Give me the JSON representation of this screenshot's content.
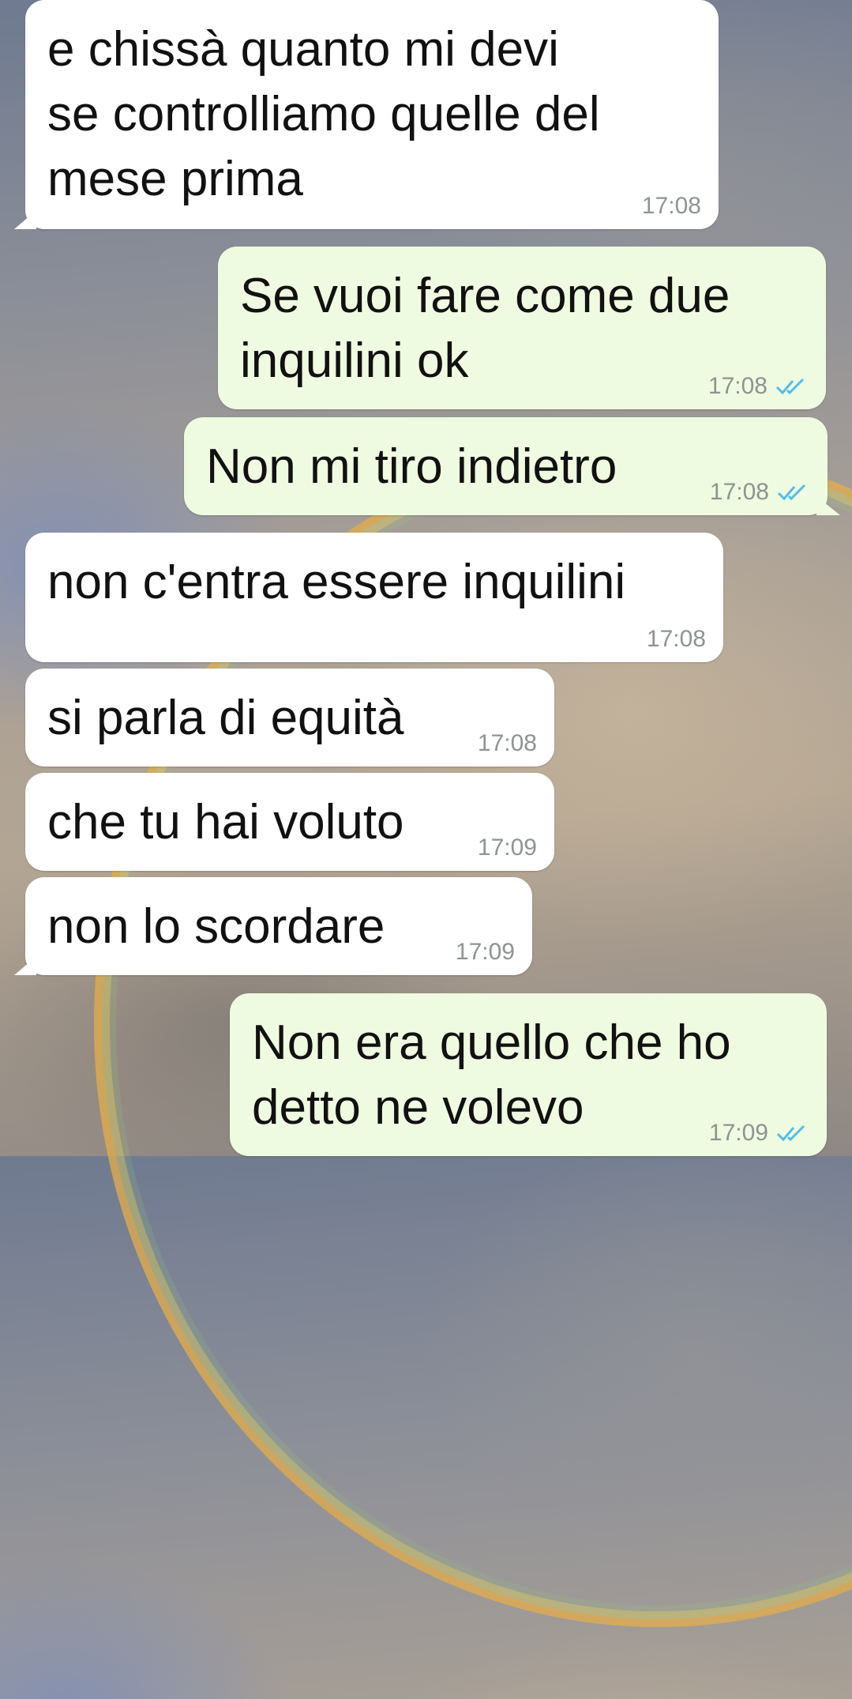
{
  "messages": [
    {
      "text": "e chissà quanto mi devi\nse controlliamo quelle del\nmese prima",
      "time": "17:08"
    },
    {
      "text": "Se vuoi fare come due\ninquilini ok",
      "time": "17:08"
    },
    {
      "text": "Non mi tiro indietro",
      "time": "17:08"
    },
    {
      "text": "non c'entra essere inquilini",
      "time": "17:08"
    },
    {
      "text": "si parla di equità",
      "time": "17:08"
    },
    {
      "text": "che tu hai voluto",
      "time": "17:09"
    },
    {
      "text": "non lo scordare",
      "time": "17:09"
    },
    {
      "text": "Non era quello che ho\ndetto ne volevo",
      "time": "17:09"
    }
  ],
  "icons": {
    "read_receipt": "double-check-icon"
  },
  "colors": {
    "incoming_bubble": "#ffffff",
    "outgoing_bubble": "#eefbe0",
    "read_tick": "#53bdeb"
  }
}
